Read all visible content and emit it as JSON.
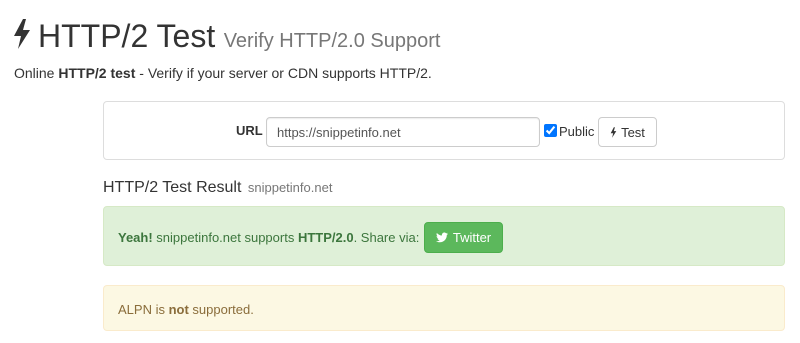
{
  "header": {
    "title": "HTTP/2 Test",
    "subtitle": "Verify HTTP/2.0 Support",
    "icon": "bolt-icon"
  },
  "lead": {
    "prefix": "Online ",
    "bold": "HTTP/2 test",
    "suffix": " - Verify if your server or CDN supports HTTP/2."
  },
  "form": {
    "url_label": "URL",
    "url_value": "https://snippetinfo.net",
    "public_label": "Public",
    "public_checked": true,
    "test_button_label": "Test"
  },
  "result": {
    "title": "HTTP/2 Test Result",
    "domain": "snippetinfo.net",
    "success": {
      "yeah": "Yeah!",
      "text_part1": " snippetinfo.net supports ",
      "protocol": "HTTP/2.0",
      "text_part2": ". Share via:",
      "twitter_label": "Twitter"
    },
    "alpn": {
      "prefix": "ALPN is ",
      "bold": "not",
      "suffix": " supported."
    }
  },
  "colors": {
    "success_bg": "#dff0d8",
    "success_text": "#3c763d",
    "warning_bg": "#fcf8e3",
    "warning_text": "#8a6d3b",
    "twitter_button": "#5cb85c"
  }
}
